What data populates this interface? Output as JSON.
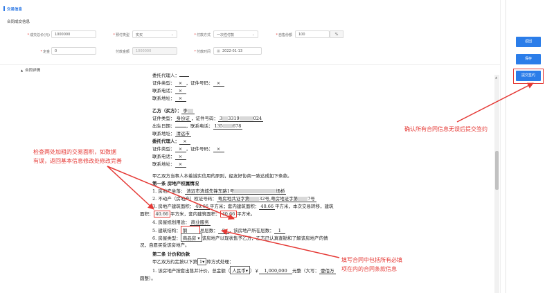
{
  "header": {
    "section_title": "交易信息",
    "sub_title": "合同成交信息"
  },
  "form": {
    "price_label": "成交总价(元)",
    "price_value": "1000000",
    "payment_type_label": "预付类型",
    "payment_type_value": "实买",
    "pay_method_label": "付款方式",
    "pay_method_value": "一次性付款",
    "own_share_label": "自售份额",
    "own_share_value": "100",
    "pct": "%",
    "deposit_label": "定金",
    "deposit_value": "0",
    "pay_amount_label": "付款金额",
    "pay_amount_value": "1000000",
    "pay_time_label": "付款时间",
    "pay_time_value": "2022-01-13"
  },
  "contract_section": {
    "label": "合同详情"
  },
  "doc": {
    "line0": "委托代理人：",
    "line1_a": "证件类型：",
    "line1_b": "，证件号码：",
    "mark": "×",
    "line2": "联系电话：",
    "line3": "联系地址：",
    "partyb_title": "乙方（买方）：",
    "partyb_name": "李",
    "id_type_label": "证件类型：",
    "id_type_value": "身份证",
    "id_no_label": "，证件号码：",
    "id_no_a": "3",
    "id_no_b": "3319",
    "id_no_c": "024",
    "birth_label": "出生日期：",
    "phone_label": "，联系电话：",
    "phone_a": "135",
    "phone_b": "678",
    "addr_label": "联系地址：",
    "addr_value": "清远市",
    "agent2_title": "委托代理人：",
    "agreement": "甲乙双方当事人本着诚实信用的原则，经友好协商一致达成如下条款。",
    "art1_title": "第一条  房地产权属情况",
    "art1_l1_a": "1. 房地产坐落：",
    "art1_l1_b": "清远市清城先锋东路1号",
    "art1_l1_c": "场桥",
    "art1_l2_a": "2. 不动产（房地产）权证号码：",
    "art1_l2_b": "粤房地共证字第",
    "art1_l2_c": "32号,粤房地证字第",
    "art1_l2_d": "7号",
    "art1_l3_a": "3. 房地产建筑面积：",
    "art1_l3_area": "40.66",
    "art1_l3_b": "平方米；套内建筑面积：",
    "art1_l3_inner": "40.66",
    "art1_l3_c": "平方米，本次交易转移，建筑",
    "art1_l4_a": "面积：",
    "art1_l4_area": "40.66",
    "art1_l4_b": "平方米，套内建筑面积：",
    "art1_l4_inner": "40.66",
    "art1_l4_c": "平方米。",
    "art1_l5_a": "4. 房屋规划用途：",
    "art1_l5_b": "商业服务",
    "art1_l6_a": "5. 建筑结构：",
    "art1_l6_b": "钢",
    "art1_l6_c": "总层数：",
    "art1_l6_d": "8",
    "art1_l6_e": "，该房地产所在层数：",
    "art1_l6_f": "1",
    "art1_l7_a": "6. 房屋类型：",
    "art1_l7_b": "商品房",
    "art1_l7_c": "该房地产以现状售予乙方，乙方已认真查勘和了解该房地产的情",
    "art1_l8": "况，自愿买受该房地产。",
    "art2_title": "第二条  计价和价款",
    "art2_l1_a": "甲乙双方约定按以下第",
    "art2_l1_b": "1",
    "art2_l1_c": "种方式处理：",
    "art2_l2_a": "1. 该房地产按套出售并计价，总金额（",
    "art2_l2_b": "人民币",
    "art2_l2_c": "）￥",
    "art2_l2_d": "1,000,000",
    "art2_l2_e": "元整（大写：",
    "art2_l2_f": "壹佰万",
    "art2_l3": "圆整）。"
  },
  "actions": {
    "back": "返回",
    "save": "保存",
    "submit": "提交签约"
  },
  "annotations": {
    "left_note_1": "检查两处加粗的交易面积，如数据",
    "left_note_2": "有误，返回基本信息修改处修改完善",
    "right_note": "确认所有合同信息无误后提交签约",
    "bottom_note_1": "填写合同中包括所有必填",
    "bottom_note_2": "项在内的合同条款信息"
  }
}
